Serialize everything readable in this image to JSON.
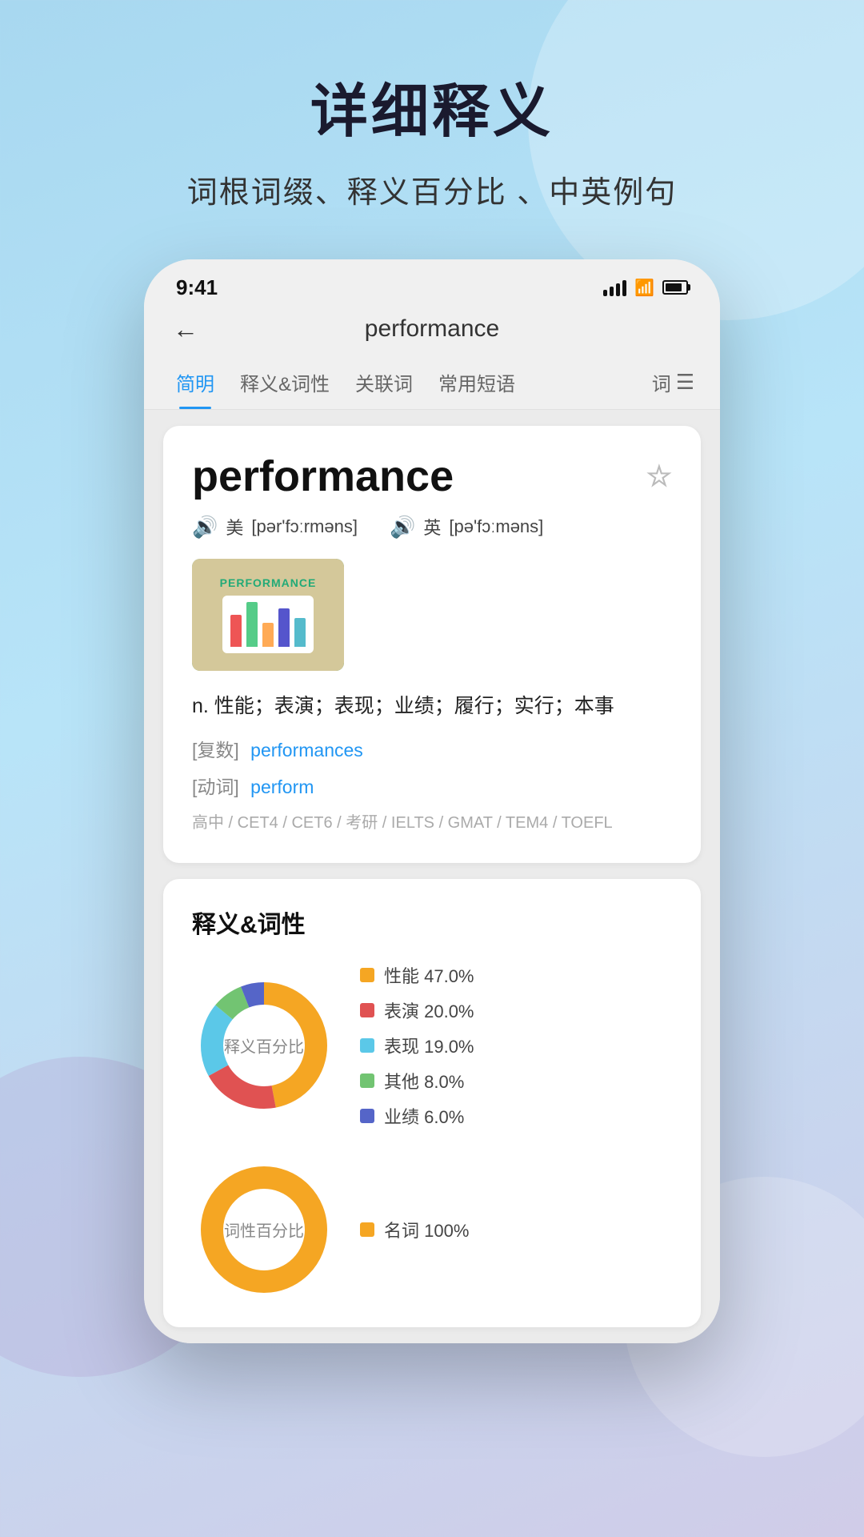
{
  "page": {
    "background": "#a8d8f0",
    "main_title": "详细释义",
    "subtitle": "词根词缀、释义百分比 、中英例句"
  },
  "status_bar": {
    "time": "9:41",
    "signal": "4 bars",
    "wifi": "on",
    "battery": "full"
  },
  "app_header": {
    "back_label": "←",
    "title": "performance"
  },
  "nav_tabs": [
    {
      "id": "brief",
      "label": "简明",
      "active": true
    },
    {
      "id": "definition",
      "label": "释义&词性",
      "active": false
    },
    {
      "id": "related",
      "label": "关联词",
      "active": false
    },
    {
      "id": "phrases",
      "label": "常用短语",
      "active": false
    },
    {
      "id": "more",
      "label": "词",
      "active": false
    }
  ],
  "word_card": {
    "word": "performance",
    "star_icon": "☆",
    "pronunciations": [
      {
        "region": "美",
        "phonetic": "[pər'fɔːrməns]"
      },
      {
        "region": "英",
        "phonetic": "[pə'fɔːməns]"
      }
    ],
    "definition": "n.  性能；表演；表现；业绩；履行；实行；本事",
    "inflections": [
      {
        "label": "[复数]",
        "word": "performances"
      },
      {
        "label": "[动词]",
        "word": "perform"
      }
    ],
    "levels": "高中 / CET4 / CET6 / 考研 / IELTS / GMAT / TEM4 / TOEFL"
  },
  "def_section": {
    "title": "释义&词性",
    "meaning_chart_label": "释义百分比",
    "meaning_legend": [
      {
        "label": "性能 47.0%",
        "color": "#F5A623"
      },
      {
        "label": "表演 20.0%",
        "color": "#E05252"
      },
      {
        "label": "表现 19.0%",
        "color": "#5BC8E8"
      },
      {
        "label": "其他 8.0%",
        "color": "#72C472"
      },
      {
        "label": "业绩 6.0%",
        "color": "#5565C8"
      }
    ],
    "pos_chart_label": "词性百分比",
    "pos_legend": [
      {
        "label": "名词 100%",
        "color": "#F5A623"
      }
    ]
  }
}
